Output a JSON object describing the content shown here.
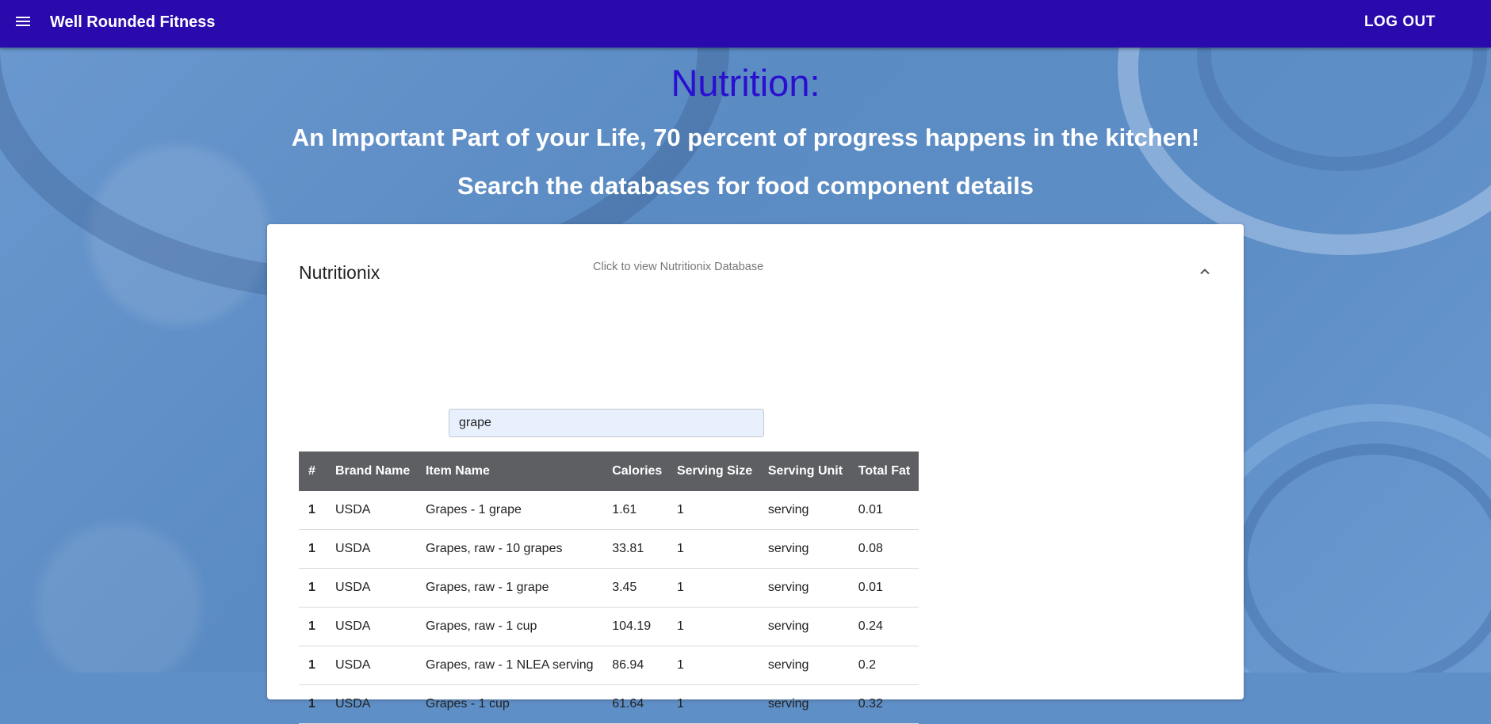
{
  "appbar": {
    "title": "Well Rounded Fitness",
    "logout_label": "LOG OUT"
  },
  "hero": {
    "title": "Nutrition:",
    "subtitle_1": "An Important Part of your Life, 70 percent of progress happens in the kitchen!",
    "subtitle_2": "Search the databases for food component details"
  },
  "panel": {
    "title": "Nutritionix",
    "hint": "Click to view Nutritionix Database",
    "search_value": "grape"
  },
  "table": {
    "headers": [
      "#",
      "Brand Name",
      "Item Name",
      "Calories",
      "Serving Size",
      "Serving Unit",
      "Total Fat"
    ],
    "rows": [
      [
        "1",
        "USDA",
        "Grapes - 1 grape",
        "1.61",
        "1",
        "serving",
        "0.01"
      ],
      [
        "1",
        "USDA",
        "Grapes, raw - 10 grapes",
        "33.81",
        "1",
        "serving",
        "0.08"
      ],
      [
        "1",
        "USDA",
        "Grapes, raw - 1 grape",
        "3.45",
        "1",
        "serving",
        "0.01"
      ],
      [
        "1",
        "USDA",
        "Grapes, raw - 1 cup",
        "104.19",
        "1",
        "serving",
        "0.24"
      ],
      [
        "1",
        "USDA",
        "Grapes, raw - 1 NLEA serving",
        "86.94",
        "1",
        "serving",
        "0.2"
      ],
      [
        "1",
        "USDA",
        "Grapes - 1 cup",
        "61.64",
        "1",
        "serving",
        "0.32"
      ]
    ]
  },
  "colors": {
    "appbar": "#2a0aad",
    "title": "#2a0fd0",
    "table_header": "#5d5f63"
  },
  "icons": {
    "menu": "menu-icon",
    "chevron": "chevron-up-icon"
  }
}
